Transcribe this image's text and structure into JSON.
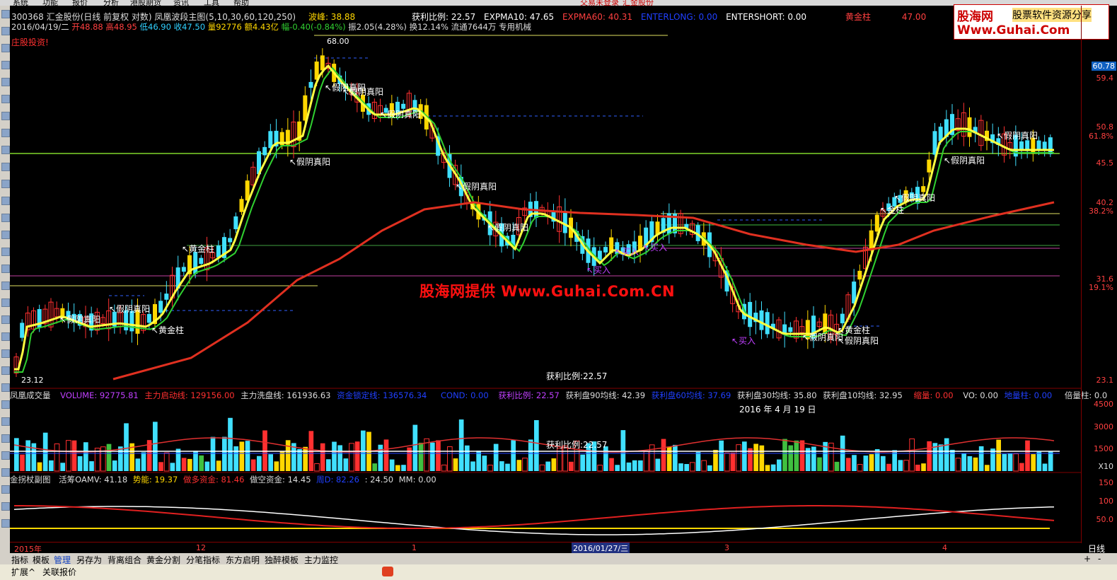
{
  "menu": [
    "系统",
    "功能",
    "报价",
    "分析",
    "港股期货",
    "资讯",
    "工具",
    "帮助"
  ],
  "menu_right": {
    "login": "交易未登录",
    "stock": "汇金股份"
  },
  "title_line": {
    "code_name": "300368 汇金股份(日线 前复权 对数) 凤凰波段主图(5,10,30,60,120,250)",
    "wave_label": "波峰: 38.88",
    "profit_ratio": "获利比例: 22.57",
    "expma10": "EXPMA10: 47.65",
    "expma60": "EXPMA60: 40.31",
    "enterlong": "ENTERLONG: 0.00",
    "entershort": "ENTERSHORT: 0.00",
    "gold_pillar": "黄金柱",
    "gold_val": "47.00"
  },
  "day_line": {
    "date": "2016/04/19/二",
    "open": "开48.88",
    "high": "高48.95",
    "low": "低46.90",
    "close": "收47.50",
    "volume": "量92776",
    "amount": "额4.43亿",
    "change": "幅-0.40(-0.84%)",
    "amp": "振2.05(4.28%)",
    "turnover": "换12.14%",
    "float": "流通7644万",
    "industry": "专用机械"
  },
  "main_chart": {
    "corner_label": "庄股投资!",
    "max_price": "68.00",
    "min_price": "23.12",
    "profit_ratio_center": "获利比例:22.57",
    "watermark": "股海网提供 Www.Guhai.Com.CN",
    "annotations": [
      {
        "t": "假阴真阳",
        "kind": "jia"
      },
      {
        "t": "假阴真阳",
        "kind": "jia"
      },
      {
        "t": "假阴真阳",
        "kind": "jia"
      },
      {
        "t": "假阴真阳",
        "kind": "jia"
      },
      {
        "t": "假阴真阳",
        "kind": "jia"
      },
      {
        "t": "假阴真阳",
        "kind": "jia"
      },
      {
        "t": "假阴真阳",
        "kind": "jia"
      },
      {
        "t": "假阴真阳",
        "kind": "jia"
      },
      {
        "t": "假阴真阳",
        "kind": "jia"
      },
      {
        "t": "假阴真阳",
        "kind": "jia"
      },
      {
        "t": "假阴真阳",
        "kind": "jia"
      },
      {
        "t": "假阴真阳",
        "kind": "jia"
      },
      {
        "t": "假阴真阳",
        "kind": "jia"
      },
      {
        "t": "黄金柱",
        "kind": "gold"
      },
      {
        "t": "黄金柱",
        "kind": "gold"
      },
      {
        "t": "黄金柱",
        "kind": "gold"
      },
      {
        "t": "金柱",
        "kind": "gold"
      },
      {
        "t": "买入",
        "kind": "buy"
      },
      {
        "t": "买入",
        "kind": "buy"
      },
      {
        "t": "买入",
        "kind": "buy"
      },
      {
        "t": "买入",
        "kind": "buy"
      }
    ]
  },
  "price_axis": [
    "60.78",
    "59.4",
    "50.8",
    "61.8%",
    "45.5",
    "40.2",
    "38.2%",
    "31.6",
    "19.1%",
    "23.1"
  ],
  "logo": {
    "line1": "股海网",
    "line2": "股票软件资源分享",
    "line3": "Www.Guhai.Com"
  },
  "vol_panel": {
    "name": "凤凰成交量",
    "volume": "VOLUME: 92775.81",
    "zl_start": "主力启动线: 129156.00",
    "zl_wash": "主力洗盘线: 161936.63",
    "zl_lock": "资金锁定线: 136576.34",
    "cond": "COND: 0.00",
    "profit": "获利比例: 22.57",
    "p90": "获利盘90均线: 42.39",
    "p60": "获利盘60均线: 37.69",
    "p30": "获利盘30均线: 35.80",
    "p10": "获利盘10均线: 32.95",
    "shrink": "缩量: 0.00",
    "vo": "VO: 0.00",
    "min_vol": "地量柱: 0.00",
    "double": "倍量柱: 0.0",
    "date_label": "2016 年 4 月 19 日",
    "center_profit": "获利比例:22.57",
    "axis": [
      "4500",
      "3000",
      "1500",
      "X10"
    ]
  },
  "osc_panel": {
    "name": "金拐杖副图",
    "oamv": "活筹OAMV: 41.18",
    "trend": "势能: 19.37",
    "bull": "做多资金: 81.46",
    "bear": "做空资金: 14.45",
    "zz": "周D: 82.26",
    "c": ": 24.50",
    "mm": "MM: 0.00",
    "axis": [
      "150",
      "100",
      "50.0"
    ]
  },
  "date_axis": {
    "labels": [
      "2015年",
      "12",
      "1",
      "2016/01/27/三",
      "3",
      "4"
    ],
    "period": "日线"
  },
  "tabs": [
    "指标",
    "模板",
    "管理",
    "另存为",
    "背离组合",
    "黄金分割",
    "分笔指标",
    "东方启明",
    "独醉模板",
    "主力监控"
  ],
  "status": [
    "扩展^",
    "关联报价"
  ],
  "colors": {
    "up": "#ff3030",
    "down": "#40e0ff",
    "ma5": "#ffff40",
    "ma10": "#30d030",
    "ma60": "#e03020",
    "gold": "#ffd700",
    "purple": "#c040ff"
  }
}
